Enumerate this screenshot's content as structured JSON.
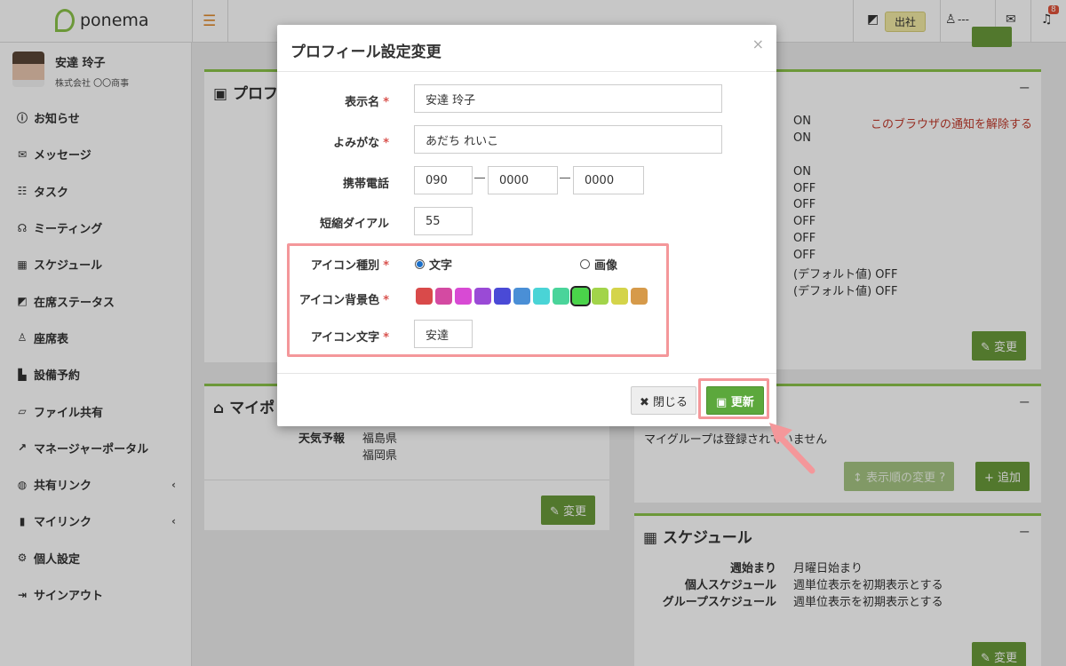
{
  "topbar": {
    "app_name": "ponema",
    "attendance_badge": "出社",
    "seat_status": "---",
    "notification_count": "8"
  },
  "user": {
    "name": "安達 玲子",
    "company": "株式会社 〇〇商事"
  },
  "sidebar": {
    "items": [
      {
        "label": "お知らせ",
        "icon": "info-icon",
        "glyph": "ⓘ"
      },
      {
        "label": "メッセージ",
        "icon": "envelope-icon",
        "glyph": "✉"
      },
      {
        "label": "タスク",
        "icon": "tasks-icon",
        "glyph": "☷"
      },
      {
        "label": "ミーティング",
        "icon": "comments-icon",
        "glyph": "☊"
      },
      {
        "label": "スケジュール",
        "icon": "calendar-icon",
        "glyph": "▦"
      },
      {
        "label": "在席ステータス",
        "icon": "status-icon",
        "glyph": "◩"
      },
      {
        "label": "座席表",
        "icon": "seat-icon",
        "glyph": "♙"
      },
      {
        "label": "設備予約",
        "icon": "facility-icon",
        "glyph": "▙"
      },
      {
        "label": "ファイル共有",
        "icon": "folder-icon",
        "glyph": "▱"
      },
      {
        "label": "マネージャーポータル",
        "icon": "chart-icon",
        "glyph": "↗"
      },
      {
        "label": "共有リンク",
        "icon": "globe-icon",
        "glyph": "◍"
      },
      {
        "label": "マイリンク",
        "icon": "bookmark-icon",
        "glyph": "▮"
      },
      {
        "label": "個人設定",
        "icon": "gear-icon",
        "glyph": "⚙"
      },
      {
        "label": "サインアウト",
        "icon": "sign-out-icon",
        "glyph": "⇥"
      }
    ]
  },
  "background": {
    "profile_panel_title": "プロフ",
    "notify_values": [
      "ON",
      "ON",
      "ON",
      "OFF",
      "OFF",
      "OFF",
      "OFF",
      "OFF",
      "(デフォルト値) OFF",
      "(デフォルト値) OFF"
    ],
    "notify_release_link": "このブラウザの通知を解除する",
    "change_label": "変更",
    "mypage_panel_title": "マイポ",
    "weather_label": "天気予報",
    "weather_values": [
      "福島県",
      "福岡県"
    ],
    "mygroup_text": "マイグループは登録されていません",
    "display_order_button": "表示順の変更",
    "add_button": "追加",
    "schedule_panel_title": "スケジュール",
    "schedule_rows": [
      {
        "label": "週始まり",
        "value": "月曜日始まり"
      },
      {
        "label": "個人スケジュール",
        "value": "週単位表示を初期表示とする"
      },
      {
        "label": "グループスケジュール",
        "value": "週単位表示を初期表示とする"
      }
    ]
  },
  "modal": {
    "title": "プロフィール設定変更",
    "close_glyph": "×",
    "required_mark": "*",
    "fields": {
      "display_name": {
        "label": "表示名",
        "value": "安達 玲子"
      },
      "reading": {
        "label": "よみがな",
        "value": "あだち れいこ"
      },
      "mobile": {
        "label": "携帯電話",
        "part1": "090",
        "part2": "0000",
        "part3": "0000"
      },
      "short_dial": {
        "label": "短縮ダイアル",
        "value": "55"
      },
      "icon_type": {
        "label": "アイコン種別",
        "option_text": "文字",
        "option_image": "画像",
        "selected": "文字"
      },
      "icon_bg_color": {
        "label": "アイコン背景色",
        "colors": [
          "#d94a4a",
          "#d44aa2",
          "#d84ad4",
          "#9a4ad6",
          "#4a4ad6",
          "#4a8fd6",
          "#4ad4d6",
          "#4ad49a",
          "#4ad44a",
          "#a2d44a",
          "#d4d44a",
          "#d69a4a"
        ],
        "selected_index": 8
      },
      "icon_text": {
        "label": "アイコン文字",
        "value": "安達"
      }
    },
    "close_button": "閉じる",
    "update_button": "更新"
  }
}
